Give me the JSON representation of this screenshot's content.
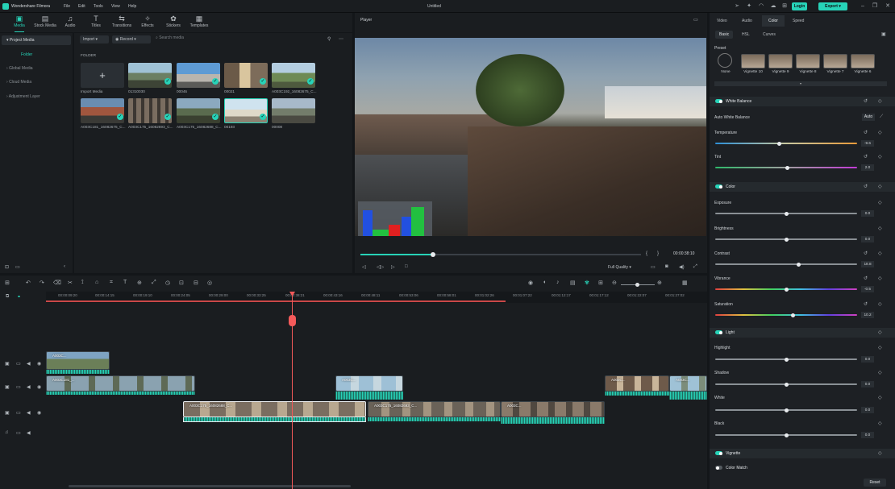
{
  "titlebar": {
    "app_name": "Wondershare Filmora",
    "menu": [
      "File",
      "Edit",
      "Tools",
      "View",
      "Help"
    ],
    "document_title": "Untitled",
    "login_label": "Login",
    "export_label": "Export"
  },
  "top_tools": [
    {
      "label": "Media",
      "icon": "media-icon"
    },
    {
      "label": "Stock Media",
      "icon": "stock-media-icon"
    },
    {
      "label": "Audio",
      "icon": "audio-icon"
    },
    {
      "label": "Titles",
      "icon": "titles-icon"
    },
    {
      "label": "Transitions",
      "icon": "transitions-icon"
    },
    {
      "label": "Effects",
      "icon": "effects-icon"
    },
    {
      "label": "Stickers",
      "icon": "stickers-icon"
    },
    {
      "label": "Templates",
      "icon": "templates-icon"
    }
  ],
  "sidebar": {
    "items": [
      "Project Media",
      "Folder",
      "Global Media",
      "Cloud Media",
      "Adjustment Layer"
    ]
  },
  "media": {
    "import_label": "Import",
    "record_label": "Record",
    "search_placeholder": "Search media",
    "folder_heading": "FOLDER",
    "import_media_label": "Import Media",
    "items": [
      "01310030",
      "00046",
      "00021",
      "A003C192_16082675_C...",
      "A003C181_16082675_C...",
      "A003C175_16082693_C...",
      "A003C175_16082688_C...",
      "00193",
      "00008"
    ]
  },
  "player": {
    "title": "Player",
    "timecode": "00:00:38:10",
    "quality": "Full Quality",
    "progress": 0.26
  },
  "right_panel": {
    "tabs": [
      "Video",
      "Audio",
      "Color",
      "Speed"
    ],
    "subtabs": [
      "Basic",
      "HSL",
      "Curves"
    ],
    "preset_label": "Preset",
    "presets": [
      "None",
      "Vignette 10",
      "Vignette 9",
      "Vignette 8",
      "Vignette 7",
      "Vignette 6"
    ],
    "white_balance": "White Balance",
    "auto_white_balance": "Auto White Balance",
    "auto_label": "Auto",
    "color_section": "Color",
    "light_section": "Light",
    "vignette_section": "Vignette",
    "color_match": "Color Match",
    "reset_label": "Reset",
    "sliders": {
      "temperature": {
        "label": "Temperature",
        "value": "-9.6",
        "level": 0.45
      },
      "tint": {
        "label": "Tint",
        "value": "2.0",
        "level": 0.51
      },
      "exposure": {
        "label": "Exposure",
        "value": "0.0",
        "level": 0.5
      },
      "brightness": {
        "label": "Brightness",
        "value": "0.0",
        "level": 0.5
      },
      "contrast": {
        "label": "Contrast",
        "value": "18.8",
        "level": 0.59
      },
      "vibrance": {
        "label": "Vibrance",
        "value": "-0.5",
        "level": 0.5
      },
      "saturation": {
        "label": "Saturation",
        "value": "10.2",
        "level": 0.55
      },
      "highlight": {
        "label": "Highlight",
        "value": "0.0",
        "level": 0.5
      },
      "shadow": {
        "label": "Shadow",
        "value": "0.0",
        "level": 0.5
      },
      "white": {
        "label": "White",
        "value": "0.0",
        "level": 0.5
      },
      "black": {
        "label": "Black",
        "value": "0.0",
        "level": 0.5
      }
    }
  },
  "timeline": {
    "ruler": [
      "00:00:09:20",
      "00:00:14:15",
      "00:00:19:10",
      "00:00:24:05",
      "00:00:29:00",
      "00:00:33:25",
      "00:00:38:21",
      "00:00:43:16",
      "00:00:48:11",
      "00:00:53:06",
      "00:00:58:01",
      "00:01:02:26",
      "00:01:07:22",
      "00:01:12:17",
      "00:01:17:12",
      "00:01:22:07",
      "00:01:27:02"
    ],
    "clips": {
      "c1": "A003C...",
      "c2": "A003C181_...",
      "c3": "A003C...",
      "c4": "A003C...",
      "c5": "A003C...",
      "c6": "A003C175_16082688_C...",
      "c7": "A003C175_16082693_C...",
      "c8": "A003C..."
    }
  },
  "colors": {
    "accent": "#27d3b8",
    "playhead": "#f45a5a",
    "panel": "#1a1d20"
  }
}
